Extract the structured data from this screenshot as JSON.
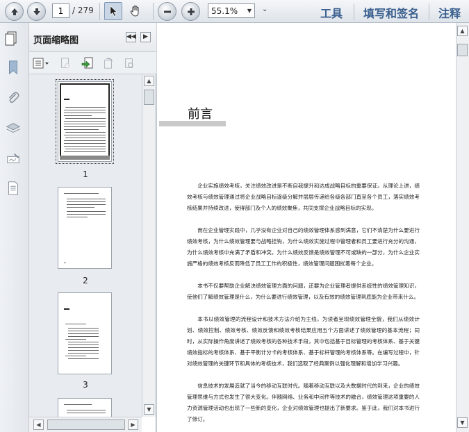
{
  "toolbar": {
    "current_page": "1",
    "page_total": "/ 279",
    "zoom": "55.1%",
    "right_links": [
      "工具",
      "填写和签名",
      "注释"
    ]
  },
  "icons": {
    "prev_page": "arrow-up-icon",
    "next_page": "arrow-down-icon",
    "select_tool": "cursor-icon",
    "hand_tool": "hand-icon",
    "zoom_out": "minus-icon",
    "zoom_in": "plus-icon"
  },
  "sidebar": {
    "title": "页面缩略图",
    "thumbnails": [
      {
        "label": "1"
      },
      {
        "label": "2"
      },
      {
        "label": "3"
      }
    ]
  },
  "document": {
    "heading": "前言",
    "paragraphs": [
      "企业实施绩效考核，关注绩效改进是不断自我提升和达成战略目标的重要保证。从理论上讲，绩效考核与绩效管理通过将企业战略目标逐级分解并层层传递给各级各部门直至各个员工，落实绩效考核结果并持续改进，使得部门及个人的绩效聚焦，共同支撑企业战略目标的实现。",
      "而在企业管理实践中，几乎没有企业对自己的绩效管理体系感到满意，它们不清楚为什么要进行绩效考核，为什么绩效管理要与战略挂钩，为什么绩效实施过程中管理者和员工要进行充分的沟通，为什么绩效考核中充满了矛盾和冲突，为什么绩效反馈是绩效管理不可或缺的一部分，为什么企业实施严格的绩效考核反而降低了员工工作的积极性，绩效管理问题困扰着每个企业。",
      "本书不仅要帮助企业解决绩效管理方面的问题，还要为企业管理者提供系统性的绩效管理知识，使他们了解绩效管理是什么，为什么要进行绩效管理，以及有效的绩效管理到底能为企业带来什么。",
      "本书以绩效管理的流程设计和技术方法介绍为主线，为读者呈现绩效管理全貌，我们从绩效计划、绩效控制、绩效考核、绩效反馈和绩效考核结果应用五个方面讲述了绩效管理的基本流程；同时，从实际操作角度讲述了绩效考核的各种技术手段，其中包括基于目标管理的考核体系、基于关键绩效指标的考核体系、基于平衡计分卡的考核体系、基于标杆管理的考核体系等。在编写过程中，针对绩效管理的关键环节和具体的考核技术，我们选取了经典案例以强化理解和增加学习兴趣。",
      "信息技术的发展造就了当今的移动互联时代。随着移动互联以及大数据时代的到来，企业的绩效管理思维与方式也发生了很大变化。伴随网络、业务和中间件等技术的融合，绩效管理这项重要的人力资源管理活动也出现了一些新的变化，企业对绩效管理也提出了新要求。鉴于此，我们对本书进行了修订。"
    ]
  }
}
